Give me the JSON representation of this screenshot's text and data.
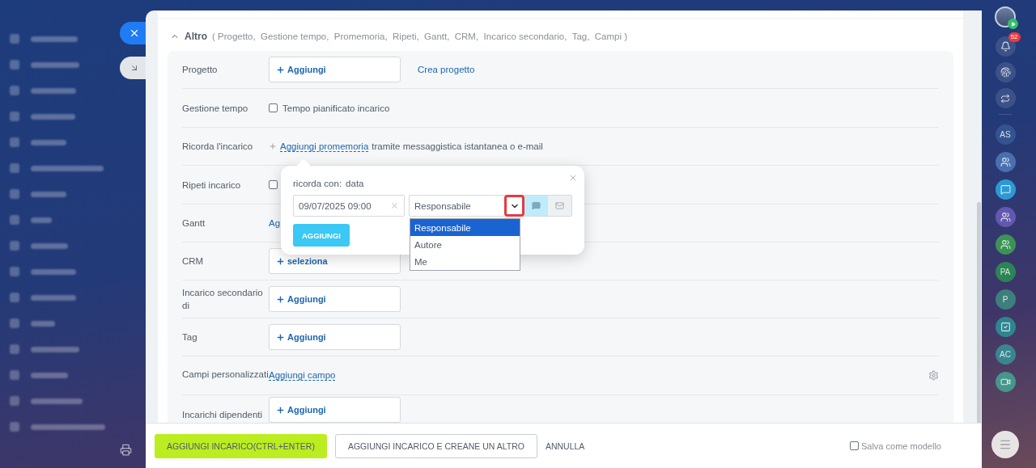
{
  "side_tabs": [
    {
      "kind": "close",
      "color": "#1f7cf5"
    },
    {
      "kind": "collapse",
      "color": "#e3e6e9"
    }
  ],
  "section": {
    "title": "Altro",
    "expanded": true,
    "summary": "( Progetto,  Gestione tempo,  Promemoria,  Ripeti,  Gantt,  CRM,  Incarico secondario,  Tag,  Campi )"
  },
  "rows": [
    {
      "label": "Progetto",
      "kind": "selector",
      "button": "Aggiungi",
      "link": "Crea progetto"
    },
    {
      "label": "Gestione tempo",
      "kind": "checkbox",
      "checked": false,
      "text": "Tempo pianificato incarico"
    },
    {
      "label": "Ricorda l'incarico",
      "kind": "reminder",
      "link": "Aggiungi promemoria",
      "text": "tramite messaggistica istantanea o e-mail"
    },
    {
      "label": "Ripeti incarico",
      "kind": "checkbox",
      "checked": false
    },
    {
      "label": "Gantt",
      "kind": "link",
      "link": "Ag"
    },
    {
      "label": "CRM",
      "kind": "selector",
      "button": "seleziona"
    },
    {
      "label": "Incarico secondario di",
      "kind": "selector",
      "button": "Aggiungi"
    },
    {
      "label": "Tag",
      "kind": "selector",
      "button": "Aggiungi"
    },
    {
      "label": "Campi personalizzati",
      "kind": "custom",
      "link": "Aggiungi campo"
    },
    {
      "label": "Incarichi dipendenti",
      "kind": "selector",
      "button": "Aggiungi"
    }
  ],
  "popup": {
    "label": "ricorda con:",
    "mode": "data",
    "date": "09/07/2025 09:00",
    "recipient": "Responsabile",
    "caret_highlighted": true,
    "channels": [
      {
        "kind": "message",
        "selected": true
      },
      {
        "kind": "email",
        "selected": false
      }
    ],
    "options": [
      {
        "label": "Responsabile",
        "selected": true
      },
      {
        "label": "Autore",
        "selected": false
      },
      {
        "label": "Me",
        "selected": false
      }
    ],
    "button": "AGGIUNGI"
  },
  "footer": {
    "buttons": [
      {
        "kind": "primary",
        "label": "AGGIUNGI INCARICO(CTRL+ENTER)"
      },
      {
        "kind": "secondary",
        "label": "AGGIUNGI INCARICO E CREANE UN ALTRO"
      },
      {
        "kind": "link",
        "label": "ANNULLA"
      }
    ],
    "save_template": {
      "label": "Salva come modello",
      "checked": false
    }
  },
  "right_bar": {
    "notifications": "52",
    "chats": [
      {
        "kind": "initials",
        "text": "AS",
        "color": "#34548f"
      },
      {
        "kind": "group",
        "color": "#4a6fae"
      },
      {
        "kind": "chat",
        "color": "#2b9ad4"
      },
      {
        "kind": "group",
        "color": "#6358b0"
      },
      {
        "kind": "group",
        "color": "#3d9356"
      },
      {
        "kind": "initials",
        "text": "PA",
        "color": "#2c8456"
      },
      {
        "kind": "initials",
        "text": "P",
        "color": "#3c7f7c"
      },
      {
        "kind": "task",
        "color": "#2e8590"
      },
      {
        "kind": "initials",
        "text": "AC",
        "color": "#3a8590"
      },
      {
        "kind": "video",
        "color": "#46968b"
      }
    ]
  }
}
